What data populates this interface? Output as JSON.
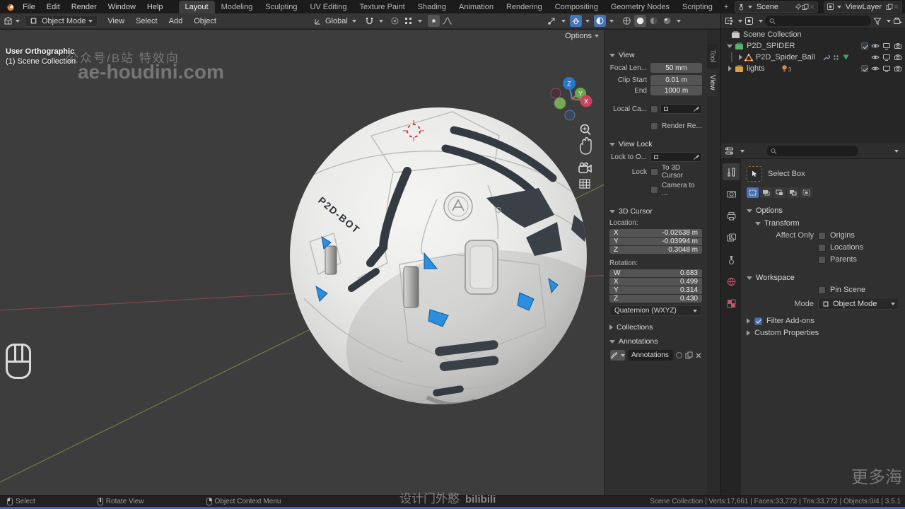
{
  "topbar": {
    "menus": [
      "File",
      "Edit",
      "Render",
      "Window",
      "Help"
    ],
    "workspaces": [
      "Layout",
      "Modeling",
      "Sculpting",
      "UV Editing",
      "Texture Paint",
      "Shading",
      "Animation",
      "Rendering",
      "Compositing",
      "Geometry Nodes",
      "Scripting"
    ],
    "add_workspace": "+",
    "scene_label": "Scene",
    "view_layer_label": "ViewLayer"
  },
  "viewport_header": {
    "mode_label": "Object Mode",
    "menu_view": "View",
    "menu_select": "Select",
    "menu_add": "Add",
    "menu_object": "Object",
    "orientation_label": "Global",
    "options_label": "Options"
  },
  "viewport": {
    "view_name": "User Orthographic",
    "active_collection": "(1) Scene Collection",
    "watermark_top": "公众号/B站 特效向",
    "watermark_main": "ae-houdini.com",
    "ball_text": "P2D-BOT",
    "axis_x": "X",
    "axis_y": "Y",
    "axis_z": "Z"
  },
  "npanel": {
    "tab_tool": "Tool",
    "tab_view": "View",
    "view": {
      "title": "View",
      "focal_label": "Focal Len...",
      "focal_value": "50 mm",
      "clip_start_label": "Clip Start",
      "clip_start_value": "0.01 m",
      "clip_end_label": "End",
      "clip_end_value": "1000 m",
      "local_camera_label": "Local Ca...",
      "render_region_label": "Render Re..."
    },
    "view_lock": {
      "title": "View Lock",
      "lock_to_label": "Lock to O...",
      "lock_label": "Lock",
      "to_3d_cursor": "To 3D Cursor",
      "camera_to_view": "Camera to ..."
    },
    "cursor3d": {
      "title": "3D Cursor",
      "location_label": "Location:",
      "rotation_label": "Rotation:",
      "loc_x_axis": "X",
      "loc_x": "-0.02638 m",
      "loc_y_axis": "Y",
      "loc_y": "-0.03994 m",
      "loc_z_axis": "Z",
      "loc_z": "0.3048 m",
      "rot_w_axis": "W",
      "rot_w": "0.683",
      "rot_x_axis": "X",
      "rot_x": "0.499",
      "rot_y_axis": "Y",
      "rot_y": "0.314",
      "rot_z_axis": "Z",
      "rot_z": "0.430",
      "rotation_mode": "Quaternion (WXYZ)"
    },
    "collections_title": "Collections",
    "annotations_title": "Annotations",
    "annotation_layer_name": "Annotations"
  },
  "outliner": {
    "root": "Scene Collection",
    "items": [
      {
        "name": "P2D_SPIDER"
      },
      {
        "name": "P2D_Spider_Ball"
      },
      {
        "name": "lights",
        "count": "3"
      }
    ]
  },
  "properties": {
    "active_tool_name": "Select Box",
    "options_title": "Options",
    "transform_title": "Transform",
    "affect_only_label": "Affect Only",
    "origins": "Origins",
    "locations": "Locations",
    "parents": "Parents",
    "workspace_title": "Workspace",
    "pin_scene": "Pin Scene",
    "mode_label": "Mode",
    "mode_value": "Object Mode",
    "filter_addons": "Filter Add-ons",
    "custom_properties": "Custom Properties"
  },
  "statusbar": {
    "hint_select": "Select",
    "hint_rotate": "Rotate View",
    "hint_context": "Object Context Menu",
    "stats": "Scene Collection | Verts:17,661 | Faces:33,772 | Tris:33,772 | Objects:0/4 | 3.5.1"
  },
  "watermarks": {
    "bottom_center": "设计门外憨",
    "bilibili": "bilibili",
    "bottom_right": "更多海"
  },
  "colors": {
    "accent": "#4772b4",
    "ball_blue": "#2b8ee0",
    "x_axis": "#c4455f",
    "y_axis": "#6aa84f",
    "z_axis": "#2a76c9"
  }
}
